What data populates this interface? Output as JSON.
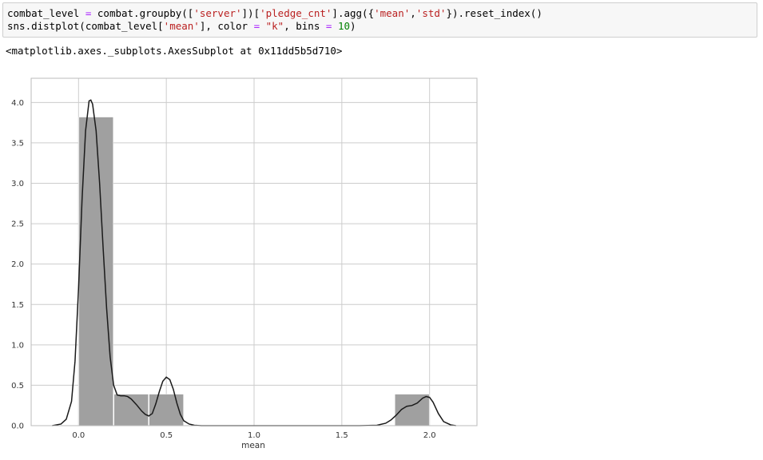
{
  "code_cell": {
    "line1": {
      "a": "combat_level ",
      "b": "=",
      "c": " combat.groupby([",
      "d": "'server'",
      "e": "])[",
      "f": "'pledge_cnt'",
      "g": "].agg({",
      "h": "'mean'",
      "i": ",",
      "j": "'std'",
      "k": "}).reset_index()"
    },
    "line2": {
      "a": "sns.distplot(combat_level[",
      "b": "'mean'",
      "c": "], color ",
      "d": "=",
      "e": " ",
      "f": "\"k\"",
      "g": ", bins ",
      "h": "=",
      "i": " ",
      "j": "10",
      "k": ")"
    }
  },
  "output_text": "<matplotlib.axes._subplots.AxesSubplot at 0x11dd5b5d710>",
  "colors": {
    "bar": "#a0a0a0",
    "kde": "#1a1a1a",
    "grid": "#cccccc",
    "frame": "#bbbbbb"
  },
  "chart_data": {
    "type": "bar",
    "subtype": "histogram_with_kde",
    "xlabel": "mean",
    "ylabel": "",
    "xlim": [
      -0.27,
      2.27
    ],
    "ylim": [
      0,
      4.3
    ],
    "grid": true,
    "xticks": [
      "0.0",
      "0.5",
      "1.0",
      "1.5",
      "2.0"
    ],
    "xtick_values": [
      0.0,
      0.5,
      1.0,
      1.5,
      2.0
    ],
    "yticks": [
      "0.0",
      "0.5",
      "1.0",
      "1.5",
      "2.0",
      "2.5",
      "3.0",
      "3.5",
      "4.0"
    ],
    "ytick_values": [
      0.0,
      0.5,
      1.0,
      1.5,
      2.0,
      2.5,
      3.0,
      3.5,
      4.0
    ],
    "bins": [
      {
        "x0": 0.0,
        "x1": 0.2,
        "value": 3.82
      },
      {
        "x0": 0.2,
        "x1": 0.4,
        "value": 0.39
      },
      {
        "x0": 0.4,
        "x1": 0.6,
        "value": 0.39
      },
      {
        "x0": 0.6,
        "x1": 0.8,
        "value": 0.0
      },
      {
        "x0": 0.8,
        "x1": 1.0,
        "value": 0.0
      },
      {
        "x0": 1.0,
        "x1": 1.2,
        "value": 0.0
      },
      {
        "x0": 1.2,
        "x1": 1.4,
        "value": 0.0
      },
      {
        "x0": 1.4,
        "x1": 1.6,
        "value": 0.0
      },
      {
        "x0": 1.6,
        "x1": 1.8,
        "value": 0.0
      },
      {
        "x0": 1.8,
        "x1": 2.0,
        "value": 0.39
      }
    ],
    "kde": {
      "x": [
        -0.15,
        -0.1,
        -0.07,
        -0.04,
        -0.02,
        0.0,
        0.02,
        0.04,
        0.06,
        0.07,
        0.08,
        0.1,
        0.12,
        0.14,
        0.16,
        0.18,
        0.2,
        0.22,
        0.24,
        0.26,
        0.28,
        0.3,
        0.33,
        0.36,
        0.38,
        0.4,
        0.42,
        0.44,
        0.46,
        0.48,
        0.5,
        0.52,
        0.54,
        0.56,
        0.58,
        0.6,
        0.63,
        0.66,
        0.7,
        0.8,
        1.0,
        1.2,
        1.4,
        1.6,
        1.7,
        1.75,
        1.78,
        1.81,
        1.84,
        1.87,
        1.9,
        1.93,
        1.96,
        1.98,
        2.0,
        2.02,
        2.05,
        2.08,
        2.12,
        2.15
      ],
      "y": [
        0.0,
        0.02,
        0.08,
        0.3,
        0.8,
        1.7,
        2.8,
        3.65,
        4.02,
        4.03,
        3.98,
        3.65,
        3.0,
        2.2,
        1.45,
        0.85,
        0.5,
        0.38,
        0.37,
        0.37,
        0.36,
        0.33,
        0.26,
        0.18,
        0.14,
        0.12,
        0.15,
        0.27,
        0.42,
        0.55,
        0.6,
        0.57,
        0.45,
        0.28,
        0.14,
        0.06,
        0.02,
        0.005,
        0.0,
        0.0,
        0.0,
        0.0,
        0.0,
        0.0,
        0.005,
        0.03,
        0.07,
        0.13,
        0.2,
        0.24,
        0.25,
        0.28,
        0.34,
        0.36,
        0.35,
        0.29,
        0.15,
        0.05,
        0.01,
        0.0
      ]
    }
  }
}
